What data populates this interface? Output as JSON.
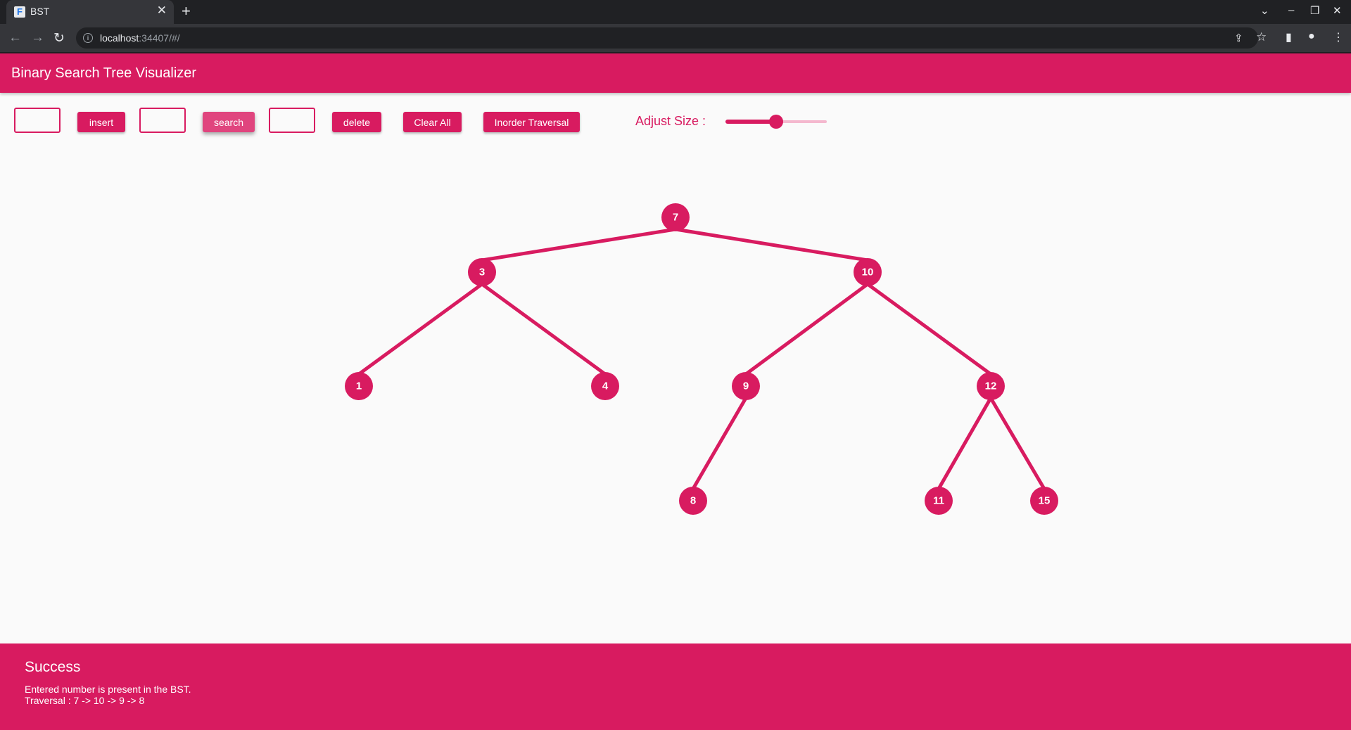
{
  "browser": {
    "tab_title": "BST",
    "url_host": "localhost",
    "url_rest": ":34407/#/",
    "icons": {
      "favicon": "flutter-icon",
      "close": "close-icon",
      "new_tab": "plus-icon",
      "back": "back-arrow-icon",
      "forward": "forward-arrow-icon",
      "reload": "reload-icon",
      "site_info": "info-icon",
      "share": "share-icon",
      "bookmark": "star-icon",
      "side_panel": "side-panel-icon",
      "profile": "profile-icon",
      "menu": "kebab-menu-icon"
    },
    "glyphs": {
      "close": "✕",
      "new_tab": "+",
      "back": "←",
      "forward": "→",
      "reload": "↻",
      "site_info": "i",
      "share": "⇪",
      "bookmark": "☆",
      "side_panel": "▮",
      "profile": "●",
      "menu": "⋮",
      "tab_search": "⌄",
      "minimize": "–",
      "maximize": "❐",
      "window_close": "✕",
      "favicon": "F"
    }
  },
  "app": {
    "title": "Binary Search Tree Visualizer",
    "accent_color": "#d81b60",
    "controls": {
      "insert_value": "",
      "insert_label": "insert",
      "search_value": "",
      "search_label": "search",
      "delete_value": "",
      "delete_label": "delete",
      "clear_label": "Clear All",
      "inorder_label": "Inorder Traversal",
      "size_label": "Adjust Size :",
      "size_fraction": 0.5
    },
    "tree": {
      "nodes": [
        "7",
        "3",
        "10",
        "1",
        "4",
        "9",
        "12",
        "8",
        "11",
        "15"
      ],
      "edges": [
        [
          "7",
          "3"
        ],
        [
          "7",
          "10"
        ],
        [
          "3",
          "1"
        ],
        [
          "3",
          "4"
        ],
        [
          "10",
          "9"
        ],
        [
          "10",
          "12"
        ],
        [
          "9",
          "8"
        ],
        [
          "12",
          "11"
        ],
        [
          "12",
          "15"
        ]
      ]
    },
    "snackbar": {
      "title": "Success",
      "message": "Entered number is present in the BST.",
      "traversal": "Traversal : 7 -> 10 -> 9 -> 8"
    }
  }
}
